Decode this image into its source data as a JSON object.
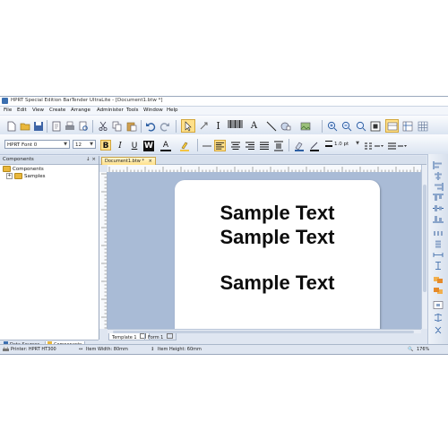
{
  "window": {
    "title": "HPRT Special Edition BarTender UltraLite - [Document1.btw *]"
  },
  "menu": [
    "File",
    "Edit",
    "View",
    "Create",
    "Arrange",
    "Administer",
    "Tools",
    "Window",
    "Help"
  ],
  "format_bar": {
    "font": "HPRT Font 0",
    "size": "12",
    "bold": "B",
    "italic": "I",
    "underline": "U",
    "reverse": "W",
    "font_color": "A",
    "line_width": "1.0 pt"
  },
  "components_panel": {
    "header": "Components",
    "controls": "↓ ×",
    "tree_root": "Components",
    "tree_child": "Samples",
    "tabs": [
      "Data Sources",
      "Components"
    ]
  },
  "document": {
    "tab": "Document1.btw *",
    "sample_texts": [
      "Sample Text",
      "Sample Text",
      "Sample Text"
    ],
    "sheet_tabs": [
      "Template 1",
      "Form 1"
    ]
  },
  "status": {
    "printer": "Printer: HPRT HT300",
    "item_width": "Item Width: 80mm",
    "item_height": "Item Height: 60mm",
    "zoom": "176%"
  },
  "colors": {
    "canvas": "#a9bbd6",
    "label": "#ffffff",
    "toolbar_accent": "#f4c542"
  }
}
